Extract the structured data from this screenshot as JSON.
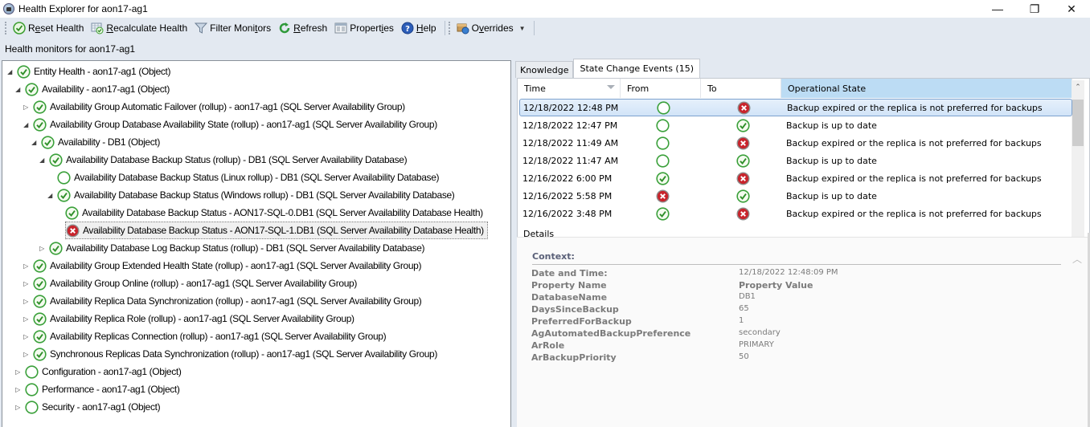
{
  "window": {
    "title": "Health Explorer for aon17-ag1",
    "minimize_glyph": "—",
    "restore_glyph": "❐",
    "close_glyph": "✕"
  },
  "toolbar": {
    "items": [
      {
        "label_pre": "R",
        "label_u": "e",
        "label_post": "set Health",
        "icon": "check-circle-icon"
      },
      {
        "label_pre": "",
        "label_u": "R",
        "label_post": "ecalculate Health",
        "icon": "recalculate-icon"
      },
      {
        "label_pre": "Filter Moni",
        "label_u": "t",
        "label_post": "ors",
        "icon": "filter-icon"
      },
      {
        "label_pre": "",
        "label_u": "R",
        "label_post": "efresh",
        "icon": "refresh-icon"
      },
      {
        "label_pre": "Propert",
        "label_u": "i",
        "label_post": "es",
        "icon": "properties-icon"
      },
      {
        "label_pre": "",
        "label_u": "H",
        "label_post": "elp",
        "icon": "help-icon"
      }
    ],
    "overrides": {
      "label_pre": "O",
      "label_u": "v",
      "label_post": "errides",
      "icon": "overrides-icon",
      "caret": "▼"
    }
  },
  "monitors_label": "Health monitors for aon17-ag1",
  "tree": [
    {
      "indent": 0,
      "expander": "expanded",
      "state": "healthy",
      "label": "Entity Health - aon17-ag1 (Object)"
    },
    {
      "indent": 1,
      "expander": "expanded",
      "state": "healthy",
      "label": "Availability - aon17-ag1 (Object)"
    },
    {
      "indent": 2,
      "expander": "collapsed",
      "state": "healthy",
      "label": "Availability Group Automatic Failover (rollup) - aon17-ag1 (SQL Server Availability Group)"
    },
    {
      "indent": 2,
      "expander": "expanded",
      "state": "healthy",
      "label": "Availability Group Database Availability State (rollup) - aon17-ag1 (SQL Server Availability Group)"
    },
    {
      "indent": 3,
      "expander": "expanded",
      "state": "healthy",
      "label": "Availability - DB1 (Object)"
    },
    {
      "indent": 4,
      "expander": "expanded",
      "state": "healthy",
      "label": "Availability Database Backup Status (rollup) - DB1 (SQL Server Availability Database)"
    },
    {
      "indent": 5,
      "expander": "none",
      "state": "unmonitored",
      "label": "Availability Database Backup Status (Linux rollup) - DB1 (SQL Server Availability Database)"
    },
    {
      "indent": 5,
      "expander": "expanded",
      "state": "healthy",
      "label": "Availability Database Backup Status (Windows rollup) - DB1 (SQL Server Availability Database)"
    },
    {
      "indent": 6,
      "expander": "none",
      "state": "healthy",
      "label": "Availability Database Backup Status - AON17-SQL-0.DB1 (SQL Server Availability Database Health)"
    },
    {
      "indent": 6,
      "expander": "none",
      "state": "critical",
      "label": "Availability Database Backup Status - AON17-SQL-1.DB1 (SQL Server Availability Database Health)",
      "selected": true
    },
    {
      "indent": 4,
      "expander": "collapsed",
      "state": "healthy",
      "label": "Availability Database Log Backup Status (rollup) - DB1 (SQL Server Availability Database)"
    },
    {
      "indent": 2,
      "expander": "collapsed",
      "state": "healthy",
      "label": "Availability Group Extended Health State (rollup) - aon17-ag1 (SQL Server Availability Group)"
    },
    {
      "indent": 2,
      "expander": "collapsed",
      "state": "healthy",
      "label": "Availability Group Online (rollup) - aon17-ag1 (SQL Server Availability Group)"
    },
    {
      "indent": 2,
      "expander": "collapsed",
      "state": "healthy",
      "label": "Availability Replica Data Synchronization (rollup) - aon17-ag1 (SQL Server Availability Group)"
    },
    {
      "indent": 2,
      "expander": "collapsed",
      "state": "healthy",
      "label": "Availability Replica Role (rollup) - aon17-ag1 (SQL Server Availability Group)"
    },
    {
      "indent": 2,
      "expander": "collapsed",
      "state": "healthy",
      "label": "Availability Replicas Connection (rollup) - aon17-ag1 (SQL Server Availability Group)"
    },
    {
      "indent": 2,
      "expander": "collapsed",
      "state": "healthy",
      "label": "Synchronous Replicas Data Synchronization (rollup) - aon17-ag1 (SQL Server Availability Group)"
    },
    {
      "indent": 1,
      "expander": "collapsed",
      "state": "unmonitored",
      "label": "Configuration - aon17-ag1 (Object)"
    },
    {
      "indent": 1,
      "expander": "collapsed",
      "state": "unmonitored",
      "label": "Performance - aon17-ag1 (Object)"
    },
    {
      "indent": 1,
      "expander": "collapsed",
      "state": "unmonitored",
      "label": "Security - aon17-ag1 (Object)"
    }
  ],
  "tabs": [
    {
      "label": "Knowledge",
      "active": false
    },
    {
      "label": "State Change Events (15)",
      "active": true
    }
  ],
  "events": {
    "columns": [
      "Time",
      "From",
      "To",
      "Operational State"
    ],
    "sorted_column": "Operational State",
    "rows": [
      {
        "time": "12/18/2022 12:48 PM",
        "from": "unmonitored",
        "to": "critical",
        "state": "Backup expired or the replica is not preferred for backups",
        "selected": true
      },
      {
        "time": "12/18/2022 12:47 PM",
        "from": "unmonitored",
        "to": "healthy",
        "state": "Backup is up to date"
      },
      {
        "time": "12/18/2022 11:49 AM",
        "from": "unmonitored",
        "to": "critical",
        "state": "Backup expired or the replica is not preferred for backups"
      },
      {
        "time": "12/18/2022 11:47 AM",
        "from": "unmonitored",
        "to": "healthy",
        "state": "Backup is up to date"
      },
      {
        "time": "12/16/2022 6:00 PM",
        "from": "healthy",
        "to": "critical",
        "state": "Backup expired or the replica is not preferred for backups"
      },
      {
        "time": "12/16/2022 5:58 PM",
        "from": "critical",
        "to": "healthy",
        "state": "Backup is up to date"
      },
      {
        "time": "12/16/2022 3:48 PM",
        "from": "healthy",
        "to": "critical",
        "state": "Backup expired or the replica is not preferred for backups"
      }
    ]
  },
  "details": {
    "label": "Details",
    "context_title": "Context:",
    "date_label": "Date and Time:",
    "date_value": "12/18/2022 12:48:09 PM",
    "prop_name_header": "Property Name",
    "prop_value_header": "Property Value",
    "properties": [
      {
        "name": "DatabaseName",
        "value": "DB1"
      },
      {
        "name": "DaysSinceBackup",
        "value": "65"
      },
      {
        "name": "PreferredForBackup",
        "value": "1"
      },
      {
        "name": "AgAutomatedBackupPreference",
        "value": "secondary"
      },
      {
        "name": "ArRole",
        "value": "PRIMARY"
      },
      {
        "name": "ArBackupPriority",
        "value": "50"
      }
    ]
  },
  "colors": {
    "healthy": "#3aa03a",
    "critical": "#c8242c",
    "unmonitored": "#3aa03a",
    "sorted_header": "#bcdcf4",
    "selection": "#d2e4f8"
  }
}
